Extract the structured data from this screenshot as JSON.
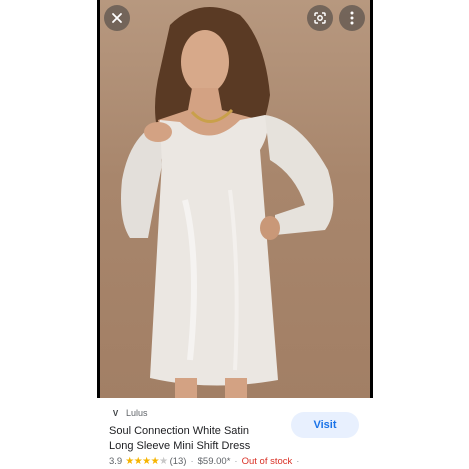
{
  "viewer": {
    "close_icon": "close-icon",
    "lens_icon": "google-lens-icon",
    "more_icon": "more-vert-icon"
  },
  "result": {
    "source_name": "Lulus",
    "source_icon": "lulus-logo-icon",
    "title_line1": "Soul Connection White Satin",
    "title_line2": "Long Sleeve Mini Shift Dress",
    "rating": "3.9",
    "rating_value": 3.9,
    "rating_max": 5,
    "review_count": "(13)",
    "price": "$59.00*",
    "stock_status": "Out of stock",
    "visit_label": "Visit"
  },
  "colors": {
    "accent": "#1a73e8",
    "button_bg": "#e8f0fe",
    "star": "#f6b400",
    "out_of_stock": "#d93025"
  }
}
